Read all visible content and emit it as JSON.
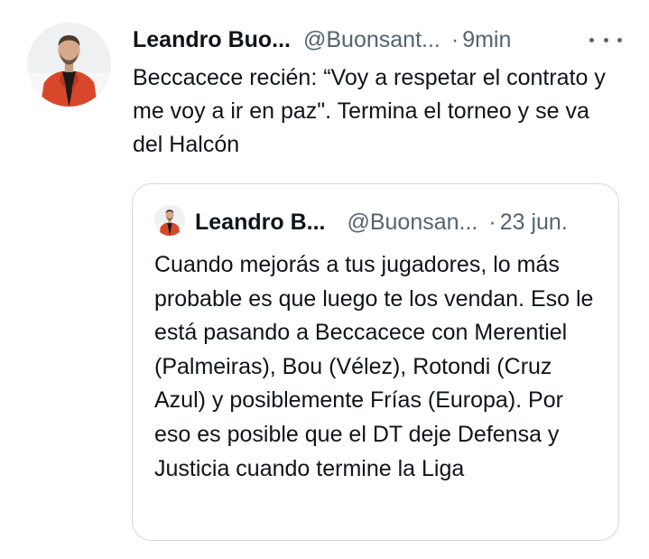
{
  "tweet": {
    "author_name": "Leandro Buo...",
    "handle": "@Buonsant...",
    "separator": "·",
    "time": "9min",
    "more_icon": "more-horizontal-icon",
    "text": "Beccacece recién: “Voy a respetar el contrato y me voy a ir en paz\". Termina el torneo y se va del Halcón"
  },
  "quoted_tweet": {
    "author_name": "Leandro B...",
    "handle": "@Buonsan...",
    "separator": "·",
    "time": "23 jun.",
    "text": "Cuando mejorás a tus jugadores, lo más probable es que luego te los vendan. Eso le está pasando a Beccacece con Merentiel (Palmeiras), Bou (Vélez), Rotondi (Cruz Azul) y posiblemente Frías (Europa). Por eso es posible que el DT deje Defensa y Justicia cuando termine la Liga"
  },
  "colors": {
    "text_primary": "#0f1419",
    "text_secondary": "#536471",
    "border": "#cfd9de",
    "avatar_jacket": "#d9472b"
  }
}
